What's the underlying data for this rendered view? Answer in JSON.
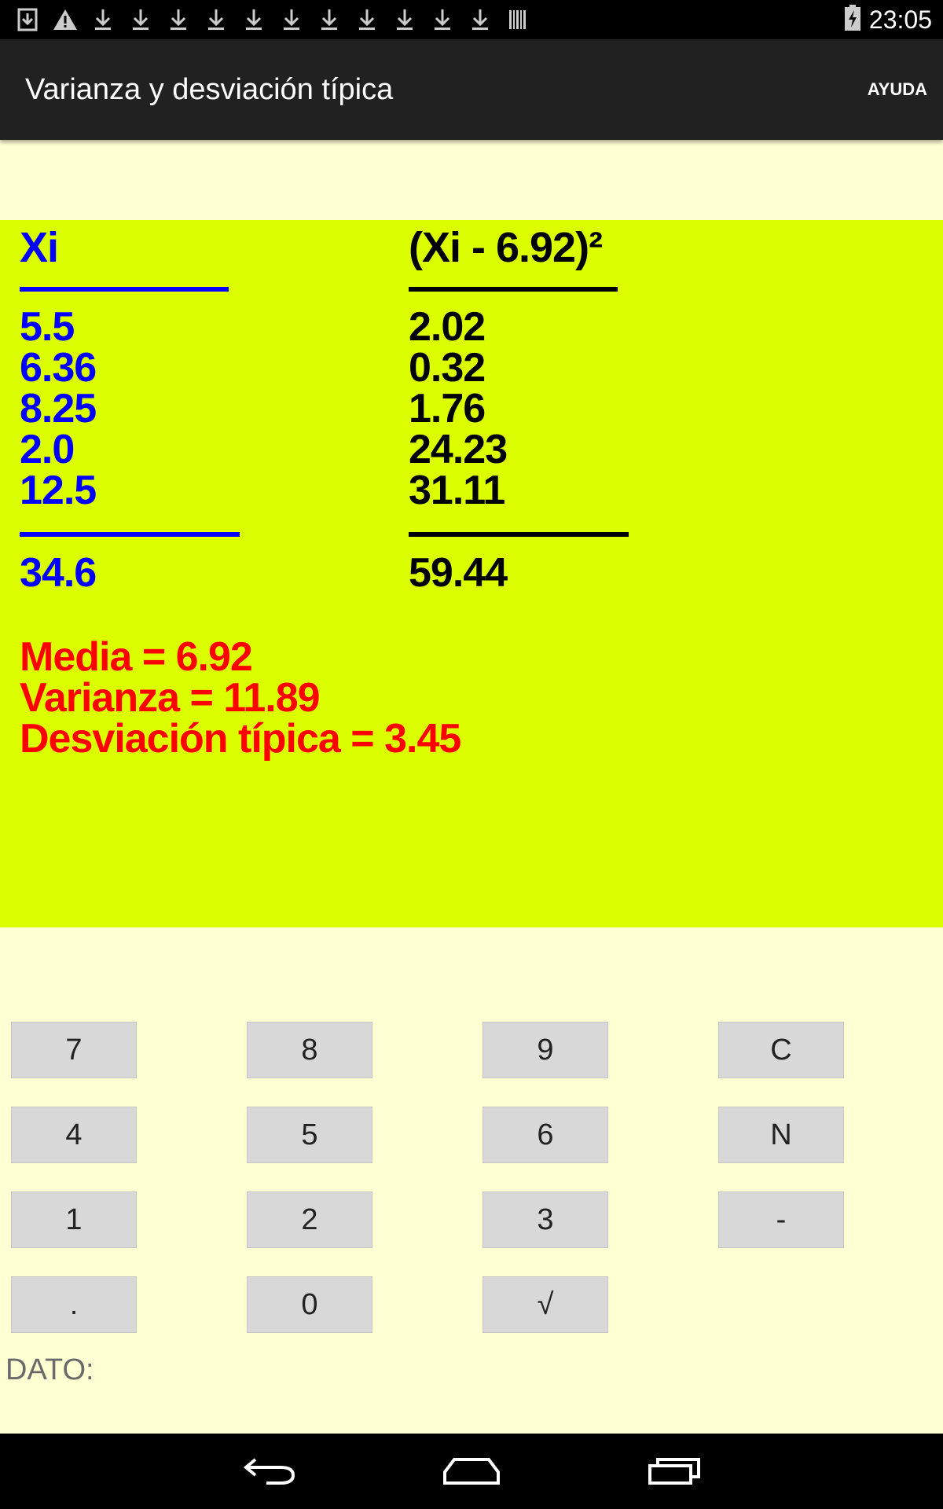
{
  "status_bar": {
    "time": "23:05",
    "icons": [
      "download-done-icon",
      "warning-icon",
      "download-icon",
      "download-icon",
      "download-icon",
      "download-icon",
      "download-icon",
      "download-icon",
      "download-icon",
      "download-icon",
      "download-icon",
      "download-icon",
      "download-icon",
      "barcode-icon"
    ],
    "battery": "battery-charging-icon"
  },
  "action_bar": {
    "title": "Varianza y desviación típica",
    "help_label": "AYUDA"
  },
  "table": {
    "xi_header": "Xi",
    "sq_header": "(Xi - 6.92)²",
    "xi_values": [
      "5.5",
      "6.36",
      "8.25",
      "2.0",
      "12.5"
    ],
    "sq_values": [
      "2.02",
      "0.32",
      "1.76",
      "24.23",
      "31.11"
    ],
    "xi_total": "34.6",
    "sq_total": "59.44"
  },
  "results": {
    "media": "Media = 6.92",
    "varianza": "Varianza = 11.89",
    "desviacion": "Desviación típica = 3.45"
  },
  "keypad": {
    "k7": "7",
    "k8": "8",
    "k9": "9",
    "kc": "C",
    "k4": "4",
    "k5": "5",
    "k6": "6",
    "kn": "N",
    "k1": "1",
    "k2": "2",
    "k3": "3",
    "kminus": "-",
    "kdot": ".",
    "k0": "0",
    "ksqrt": "√"
  },
  "input": {
    "label": "DATO:"
  },
  "colors": {
    "panel_bg": "#dcff00",
    "page_bg": "#ffffd4",
    "xi_color": "#0000ff",
    "result_color": "#ff0000"
  }
}
